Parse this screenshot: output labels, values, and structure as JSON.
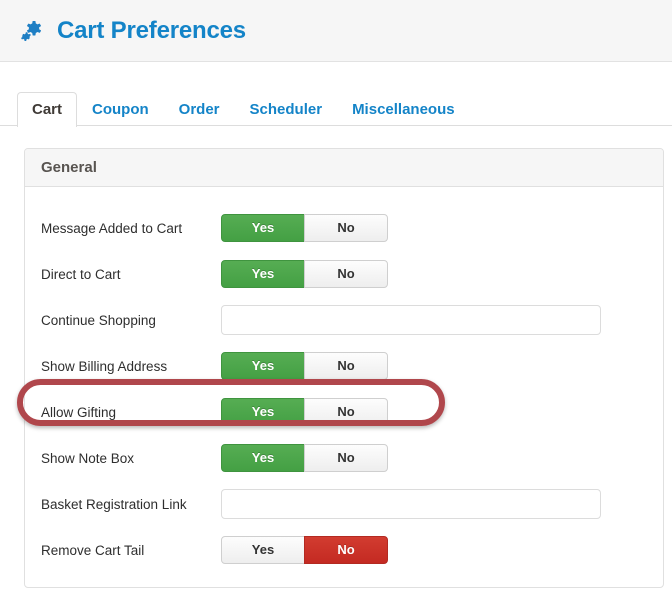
{
  "header": {
    "icon": "cogs-icon",
    "title": "Cart Preferences"
  },
  "tabs": [
    {
      "label": "Cart",
      "active": true
    },
    {
      "label": "Coupon",
      "active": false
    },
    {
      "label": "Order",
      "active": false
    },
    {
      "label": "Scheduler",
      "active": false
    },
    {
      "label": "Miscellaneous",
      "active": false
    }
  ],
  "panel": {
    "heading": "General",
    "toggle_labels": {
      "yes": "Yes",
      "no": "No"
    },
    "rows": [
      {
        "label": "Message Added to Cart",
        "type": "toggle",
        "value": "Yes",
        "yes": "Yes",
        "no": "No"
      },
      {
        "label": "Direct to Cart",
        "type": "toggle",
        "value": "Yes",
        "yes": "Yes",
        "no": "No"
      },
      {
        "label": "Continue Shopping",
        "type": "text",
        "value": "",
        "placeholder": ""
      },
      {
        "label": "Show Billing Address",
        "type": "toggle",
        "value": "Yes",
        "yes": "Yes",
        "no": "No"
      },
      {
        "label": "Allow Gifting",
        "type": "toggle",
        "value": "Yes",
        "yes": "Yes",
        "no": "No",
        "highlighted": true
      },
      {
        "label": "Show Note Box",
        "type": "toggle",
        "value": "Yes",
        "yes": "Yes",
        "no": "No"
      },
      {
        "label": "Basket Registration Link",
        "type": "text",
        "value": "",
        "placeholder": ""
      },
      {
        "label": "Remove Cart Tail",
        "type": "toggle",
        "value": "No",
        "yes": "Yes",
        "no": "No"
      }
    ]
  },
  "annotation": {
    "shape": "rounded-rectangle",
    "target_row": "Allow Gifting",
    "color": "#b0474c"
  },
  "colors": {
    "brand_blue": "#1484c8",
    "toggle_on_green": "#44a044",
    "toggle_on_red": "#c42a22",
    "toggle_off_gray": "#eeeeee",
    "panel_header_gray": "#f6f6f6",
    "annotation_red": "#b0474c"
  }
}
